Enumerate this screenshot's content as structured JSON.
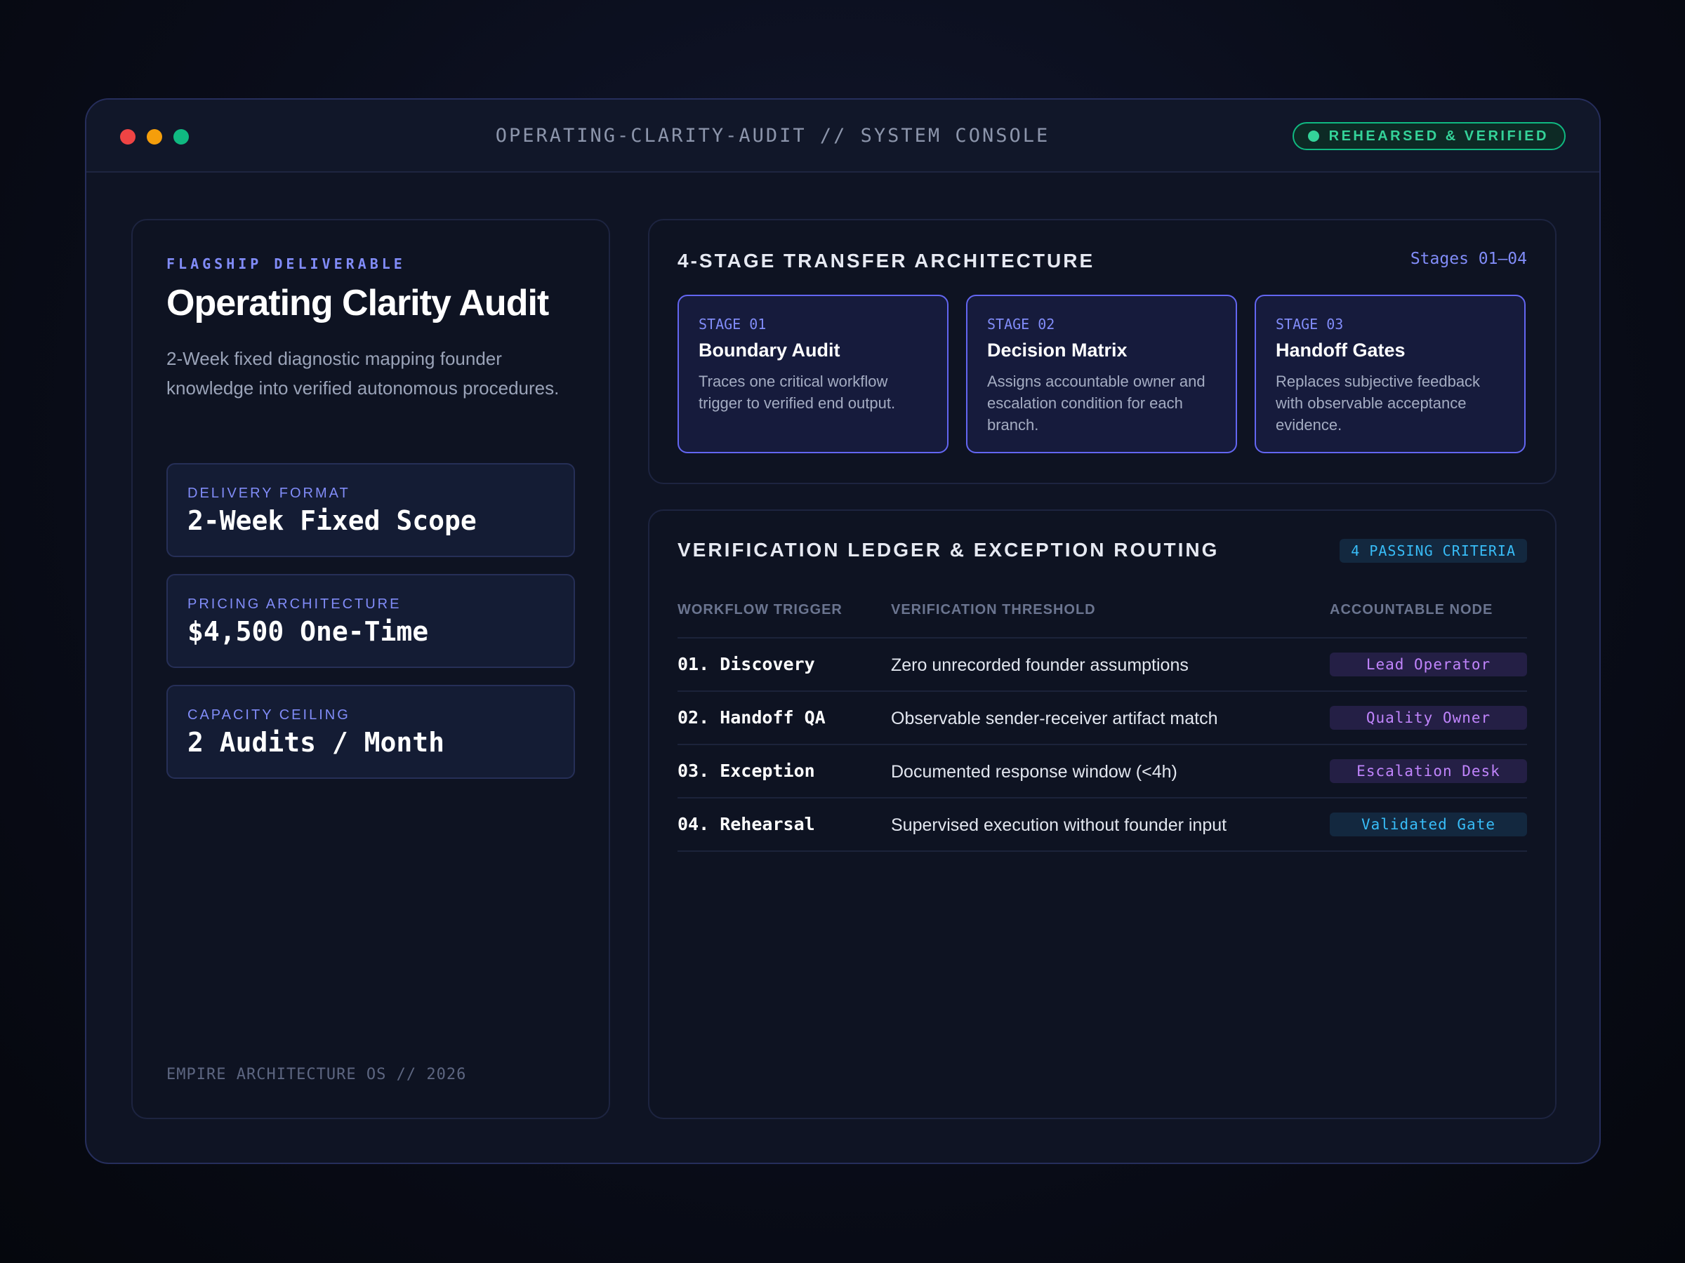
{
  "window": {
    "title": "OPERATING-CLARITY-AUDIT // SYSTEM CONSOLE",
    "status_badge": "REHEARSED & VERIFIED"
  },
  "left": {
    "eyebrow": "FLAGSHIP DELIVERABLE",
    "title": "Operating Clarity Audit",
    "description": "2-Week fixed diagnostic mapping founder knowledge into verified autonomous procedures.",
    "stats": [
      {
        "label": "DELIVERY FORMAT",
        "value": "2-Week Fixed Scope"
      },
      {
        "label": "PRICING ARCHITECTURE",
        "value": "$4,500 One-Time"
      },
      {
        "label": "CAPACITY CEILING",
        "value": "2 Audits / Month"
      }
    ],
    "footer": "EMPIRE ARCHITECTURE OS // 2026"
  },
  "architecture": {
    "title": "4-STAGE TRANSFER ARCHITECTURE",
    "stages_label": "Stages 01–04",
    "stages": [
      {
        "number": "STAGE 01",
        "name": "Boundary Audit",
        "description": "Traces one critical workflow trigger to verified end output."
      },
      {
        "number": "STAGE 02",
        "name": "Decision Matrix",
        "description": "Assigns accountable owner and escalation condition for each branch."
      },
      {
        "number": "STAGE 03",
        "name": "Handoff Gates",
        "description": "Replaces subjective feedback with observable acceptance evidence."
      }
    ]
  },
  "ledger": {
    "title": "VERIFICATION LEDGER & EXCEPTION ROUTING",
    "badge": "4 PASSING CRITERIA",
    "columns": [
      "WORKFLOW TRIGGER",
      "VERIFICATION THRESHOLD",
      "ACCOUNTABLE NODE"
    ],
    "rows": [
      {
        "trigger": "01. Discovery",
        "threshold": "Zero unrecorded founder assumptions",
        "node": "Lead Operator"
      },
      {
        "trigger": "02. Handoff QA",
        "threshold": "Observable sender-receiver artifact match",
        "node": "Quality Owner"
      },
      {
        "trigger": "03. Exception",
        "threshold": "Documented response window (<4h)",
        "node": "Escalation Desk"
      },
      {
        "trigger": "04. Rehearsal",
        "threshold": "Supervised execution without founder input",
        "node": "Validated Gate"
      }
    ]
  },
  "colors": {
    "accent": "#818cf8",
    "success": "#34d399",
    "node_purple": "#c084fc",
    "node_blue": "#38bdf8"
  }
}
